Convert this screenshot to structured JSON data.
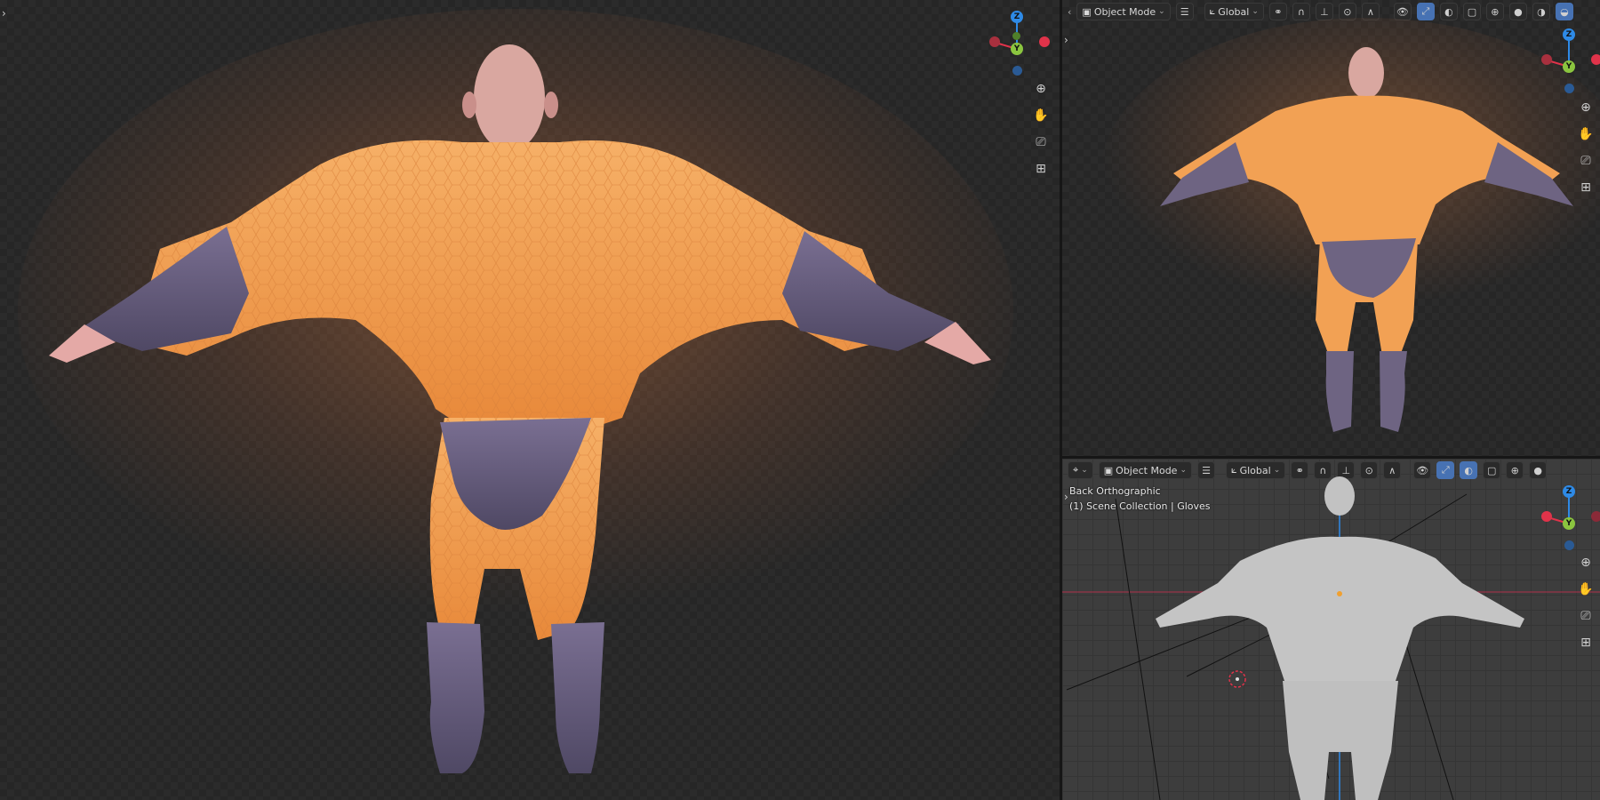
{
  "viewport_left": {
    "expand_arrow": "›",
    "gizmo": {
      "z": "Z",
      "y": "Y"
    }
  },
  "viewport_top_right": {
    "header": {
      "mode": "Object Mode",
      "orientation": "Global"
    },
    "gizmo": {
      "z": "Z",
      "y": "Y"
    }
  },
  "viewport_bottom_right": {
    "header": {
      "mode": "Object Mode",
      "orientation": "Global"
    },
    "view_name": "Back Orthographic",
    "collection_info": "(1) Scene Collection | Gloves",
    "gizmo": {
      "z": "Z",
      "y": "Y"
    }
  },
  "colors": {
    "x_axis": "#e0334a",
    "y_axis": "#8bc53f",
    "z_axis": "#2e8ae6",
    "accent": "#4772b3",
    "suit_orange": "#f3a352",
    "suit_purple": "#6e6482",
    "skin": "#d9a0a0",
    "clay": "#bdbdbd"
  },
  "icons": [
    "zoom-icon",
    "hand-pan-icon",
    "camera-icon",
    "grid-icon",
    "hamburger-menu-icon",
    "transform-icon",
    "link-icon",
    "snap-magnet-icon",
    "proportional-icon",
    "visibility-icon",
    "gizmo-icon",
    "xray-icon",
    "shading-solid-icon"
  ]
}
